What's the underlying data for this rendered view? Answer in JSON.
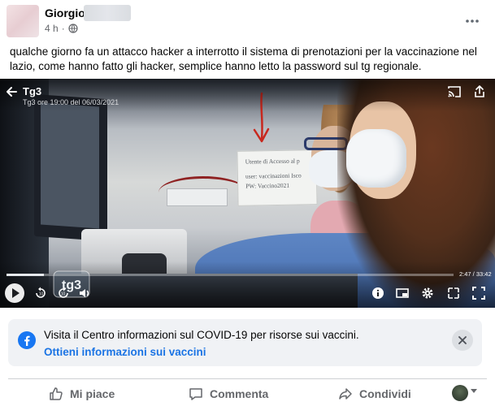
{
  "post": {
    "author": "Giorgio",
    "time": "4 h",
    "separator": "·",
    "text": "qualche giorno fa un attacco hacker a interrotto il sistema di prenotazioni per la vaccinazione nel lazio, come hanno fatto gli hacker, semplice hanno letto la password sul tg regionale.",
    "more_icon": "more-horizontal-icon"
  },
  "video": {
    "title": "Tg3",
    "subtitle": "Tg3 ore 19:00 del 06/03/2021",
    "elapsed_total": "2:47 / 33:42",
    "progress_fraction": 0.083,
    "note_lines": [
      "Utente di Accesso al p",
      "user: vaccinazioni Isco",
      "PW: Vaccino2021"
    ],
    "logo_text": "tg3",
    "icons": {
      "back": "arrow-left-icon",
      "cast": "cast-icon",
      "share": "share-icon",
      "play": "play-icon",
      "rewind": "rewind-10-icon",
      "forward": "forward-10-icon",
      "volume": "volume-icon",
      "info": "info-icon",
      "pip": "picture-in-picture-icon",
      "settings": "gear-icon",
      "hd": "hd-icon",
      "fullscreen": "fullscreen-icon"
    }
  },
  "info_box": {
    "text": "Visita il Centro informazioni sul COVID-19 per risorse sui vaccini.",
    "link": "Ottieni informazioni sui vaccini",
    "brand_color": "#1877f2"
  },
  "actions": {
    "like": "Mi piace",
    "comment": "Commenta",
    "share": "Condividi"
  },
  "colors": {
    "text_primary": "#050505",
    "text_secondary": "#65676b",
    "link": "#1b74e4",
    "annotation_red": "#c8281e"
  }
}
